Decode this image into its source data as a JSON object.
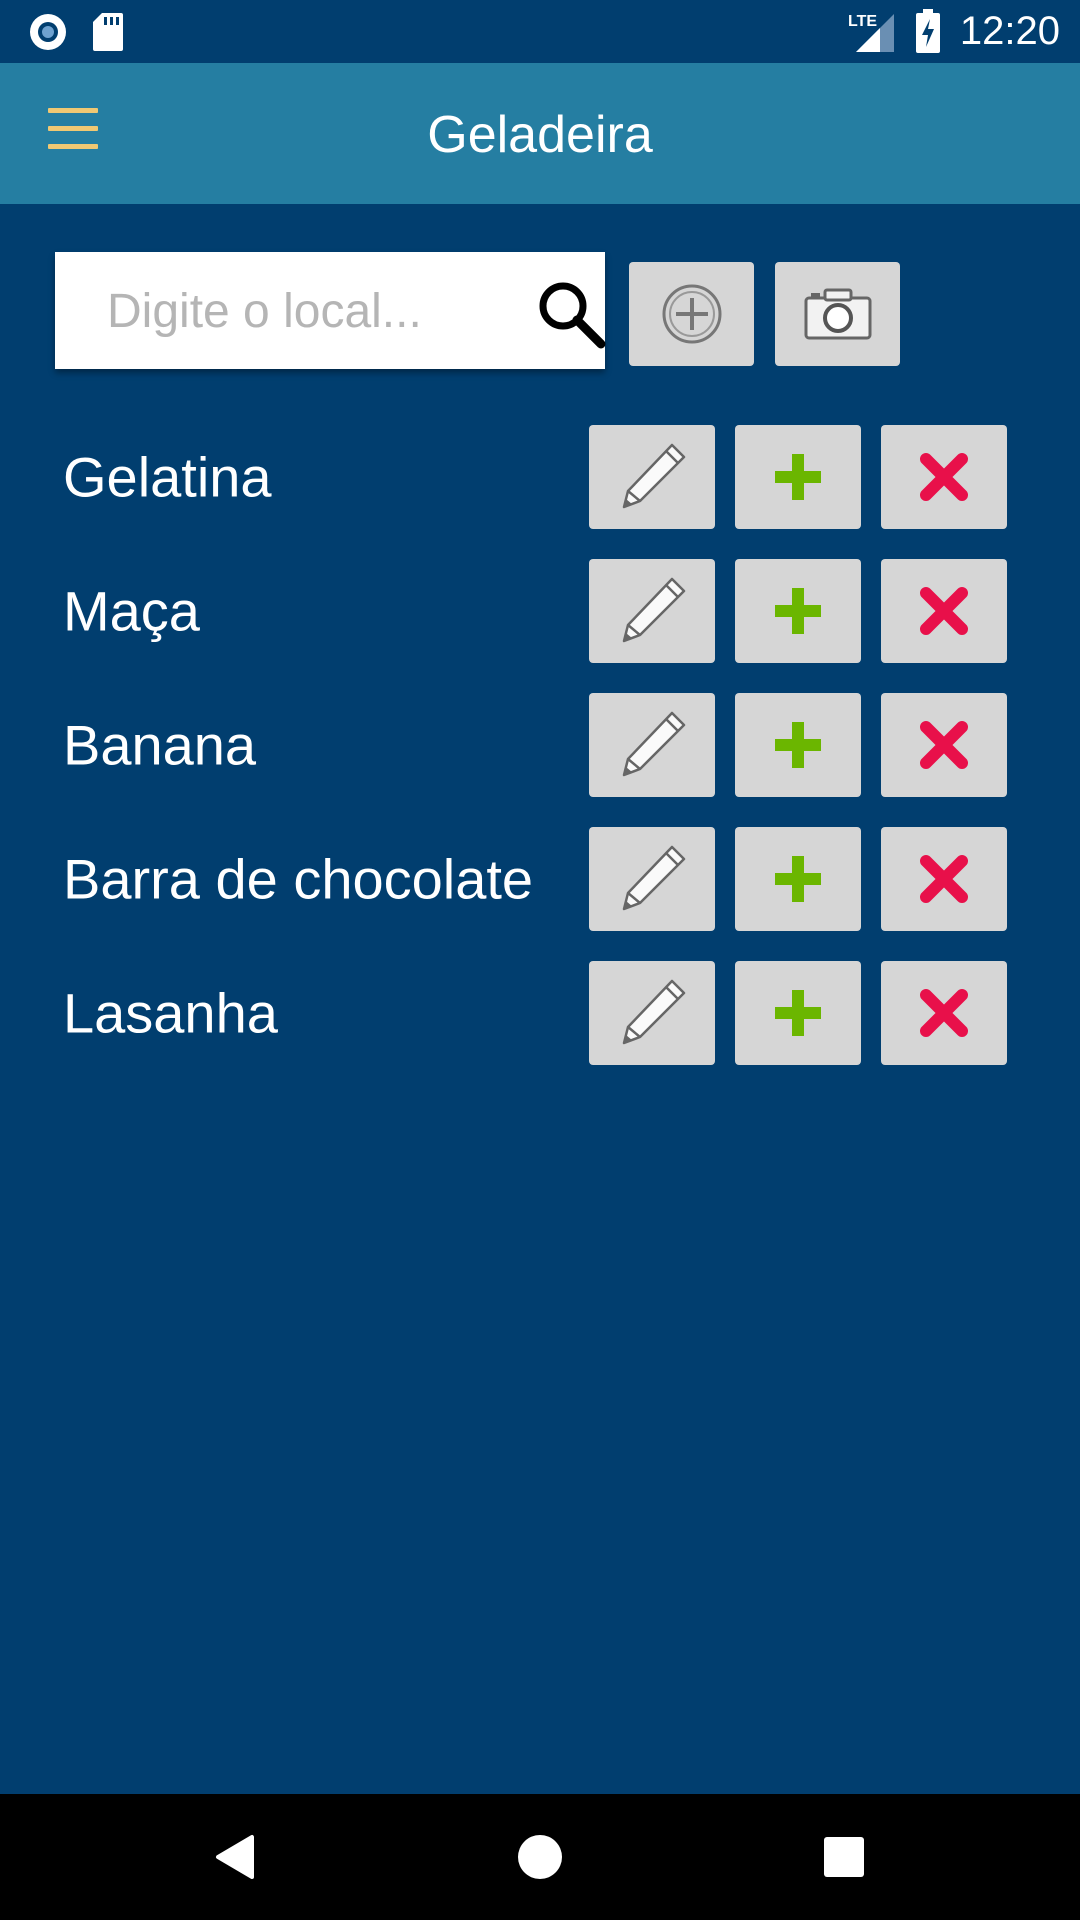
{
  "status_bar": {
    "time": "12:20",
    "network": "LTE",
    "icons": [
      "record-icon",
      "sd-card-icon",
      "lte-signal-icon",
      "battery-charging-icon"
    ]
  },
  "app_bar": {
    "title": "Geladeira",
    "menu_icon": "hamburger-menu-icon"
  },
  "search": {
    "placeholder": "Digite o local...",
    "value": "",
    "icon": "search-icon"
  },
  "toolbar": {
    "add_icon": "add-circle-icon",
    "camera_icon": "camera-icon"
  },
  "items": [
    {
      "label": "Gelatina"
    },
    {
      "label": "Maça"
    },
    {
      "label": "Banana"
    },
    {
      "label": "Barra de chocolate"
    },
    {
      "label": "Lasanha"
    }
  ],
  "row_actions": {
    "edit_icon": "pencil-icon",
    "add_icon": "green-plus-icon",
    "delete_icon": "red-x-icon"
  },
  "colors": {
    "background": "#013e6f",
    "app_bar": "#257ea2",
    "menu_icon": "#f0c873",
    "button_bg": "#d6d6d6",
    "plus_green": "#6bb600",
    "delete_red": "#e8104a"
  },
  "nav_bar": {
    "icons": [
      "back-icon",
      "home-icon",
      "recents-icon"
    ]
  }
}
